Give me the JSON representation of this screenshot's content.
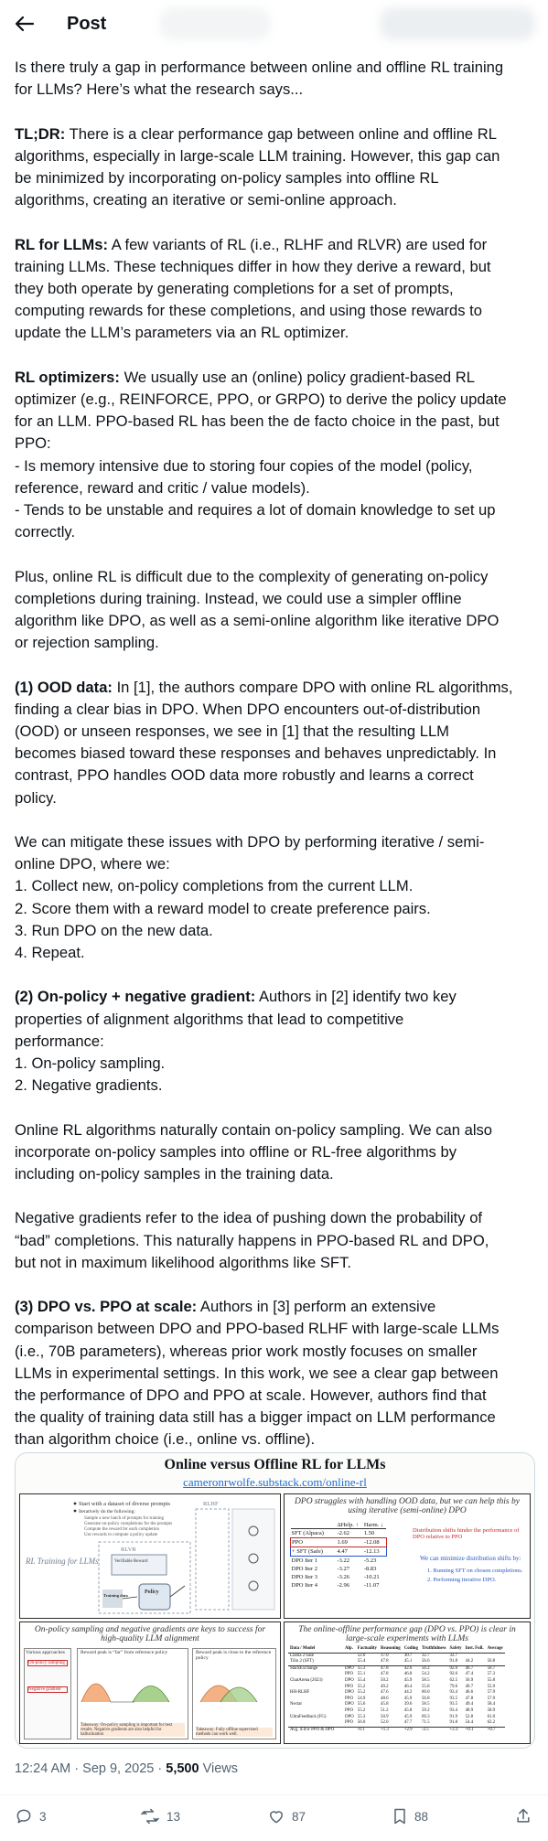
{
  "header": {
    "title": "Post"
  },
  "post": {
    "intro": [
      "Is there truly a gap in performance between online and offline RL training",
      "for LLMs? Here’s what the research says..."
    ],
    "tldr": {
      "label": "TL;DR:",
      "lines": [
        " There is a clear performance gap between online and offline RL",
        "algorithms, especially in large-scale LLM training. However, this gap can",
        "be minimized by incorporating on-policy samples into offline RL",
        "algorithms, creating an iterative or semi-online approach."
      ]
    },
    "rl_for_llms": {
      "label": "RL for LLMs:",
      "lines": [
        " A few variants of RL (i.e., RLHF and RLVR) are used for",
        "training LLMs. These techniques differ in how they derive a reward, but",
        "they both operate by generating completions for a set of prompts,",
        "computing rewards for these completions, and using those rewards to",
        "update the LLM’s parameters via an RL optimizer."
      ]
    },
    "rl_optimizers": {
      "label": "RL optimizers:",
      "lines": [
        " We usually use an (online) policy gradient-based RL",
        "optimizer (e.g., REINFORCE, PPO, or GRPO) to derive the policy update",
        "for an LLM. PPO-based RL has been the de facto choice in the past, but",
        "PPO:",
        "- Is memory intensive due to storing four copies of the model (policy,",
        "reference, reward and critic / value models).",
        "- Tends to be unstable and requires a lot of domain knowledge to set up",
        "correctly."
      ]
    },
    "plus": [
      "Plus, online RL is difficult due to the complexity of generating on-policy",
      "completions during training. Instead, we could use a simpler offline",
      "algorithm like DPO, as well as a semi-online algorithm like iterative DPO",
      "or rejection sampling."
    ],
    "ood": {
      "label": "(1) OOD data:",
      "lines": [
        " In [1], the authors compare DPO with online RL algorithms,",
        "finding a clear bias in DPO. When DPO encounters out-of-distribution",
        "(OOD) or unseen responses, we see in [1] that the resulting LLM",
        "becomes biased toward these responses and behaves unpredictably. In",
        "contrast, PPO handles OOD data more robustly and learns a correct",
        "policy."
      ]
    },
    "mitigate": [
      "We can mitigate these issues with DPO by performing iterative / semi-",
      "online DPO, where we:",
      "1. Collect new, on-policy completions from the current LLM.",
      "2. Score them with a reward model to create preference pairs.",
      "3. Run DPO on the new data.",
      "4. Repeat."
    ],
    "onpolicy": {
      "label": "(2) On-policy + negative gradient:",
      "lines": [
        " Authors in [2] identify two key",
        "properties of alignment algorithms that lead to competitive",
        "performance:",
        "1. On-policy sampling.",
        "2. Negative gradients."
      ]
    },
    "online_rl": [
      "Online RL algorithms naturally contain on-policy sampling. We can also",
      "incorporate on-policy samples into offline or RL-free algorithms by",
      "including on-policy samples in the training data."
    ],
    "neg_grad": [
      "Negative gradients refer to the idea of pushing down the probability of",
      "“bad” completions. This naturally happens in PPO-based RL and DPO,",
      "but not in maximum likelihood algorithms like SFT."
    ],
    "dpo_ppo": {
      "label": "(3) DPO vs. PPO at scale:",
      "lines": [
        " Authors in [3] perform an extensive",
        "comparison between DPO and PPO-based RLHF with large-scale LLMs",
        "(i.e., 70B parameters), whereas prior work mostly focuses on smaller",
        "LLMs in experimental settings. In this work, we see a clear gap between",
        "the performance of DPO and PPO at scale. However, authors find that",
        "the quality of training data still has a bigger impact on LLM performance",
        "than algorithm choice (i.e., online vs. offline)."
      ]
    }
  },
  "figure": {
    "title": "Online versus Offline RL for LLMs",
    "link": "cameronrwolfe.substack.com/online-rl",
    "p1": {
      "label": "RL Training for LLMs",
      "bullets": [
        "Start with a dataset of diverse prompts",
        "Iteratively do the following:",
        "Sample a new batch of prompts for training",
        "Generate on-policy completions for the prompts",
        "Compute the reward for each completion",
        "Use rewards to compute a policy update"
      ],
      "rlhf": "RLHF",
      "rlvr": "RLVR",
      "verifiable": "Verifiable Reward",
      "training_data": "Training data",
      "policy": "Policy"
    },
    "p2": {
      "title": "DPO struggles with handling OOD data, but we can help this by using iterative (semi-online) DPO",
      "cols": [
        "ΔHelp. ↑",
        "Harm. ↓"
      ],
      "rows": [
        [
          "SFT (Alpaca)",
          "-2.62",
          "1.50"
        ],
        [
          "PPO",
          "1.69",
          "-12.08"
        ],
        [
          "+ SFT (Safe)",
          "4.47",
          "-12.13"
        ],
        [
          "DPO Iter 1",
          "-3.22",
          "-5.23"
        ],
        [
          "DPO Iter 2",
          "-3.27",
          "-8.83"
        ],
        [
          "DPO Iter 3",
          "-3.26",
          "-10.21"
        ],
        [
          "DPO Iter 4",
          "-2.96",
          "-11.07"
        ]
      ],
      "note_red": "Distribution shifts hinder the performance of DPO relative to PPO",
      "note_blue": "We can minimize distribution shifts by:",
      "steps": [
        "1.  Running SFT on chosen completions.",
        "2.  Performing iterative DPO."
      ]
    },
    "p3": {
      "title": "On-policy sampling and negative gradients are keys to success for high-quality LLM alignment",
      "labels": [
        "Various approaches",
        "On-policy sampling",
        "Negative gradient",
        "Reward peak is “far” from reference policy",
        "Reward peak is close to the reference policy"
      ],
      "takeaway1": "Takeaway: On-policy sampling is important for best results. Negative gradients are also helpful for hallucination",
      "takeaway2": "Takeaway: Fully offline supervised methods can work well."
    },
    "p4": {
      "title": "The online-offline performance gap (DPO vs. PPO) is clear in large-scale experiments with LLMs",
      "cols": [
        "Data / Model",
        "Alp.",
        "Factuality",
        "Reasoning",
        "Coding",
        "Truthfulness",
        "Safety",
        "Inst. Foll.",
        "Average"
      ],
      "rows": [
        [
          "Llama 2 base",
          "",
          "52.0",
          "37.0",
          "30.7",
          "32.7",
          "32.7",
          "",
          ""
        ],
        [
          "Tülu 2 (SFT)",
          "",
          "55.4",
          "47.8",
          "45.1",
          "56.6",
          "91.8",
          "44.2",
          "56.8"
        ],
        [
          "StackExchange",
          "DPO",
          "55.3",
          "47.8",
          "42.6",
          "56.2",
          "92.0",
          "46.7",
          "56.7"
        ],
        [
          "",
          "PPO",
          "55.1",
          "47.8",
          "46.8",
          "54.2",
          "92.6",
          "47.4",
          "57.3"
        ],
        [
          "ChatArena (2023)",
          "DPO",
          "55.4",
          "50.2",
          "45.9",
          "58.5",
          "62.5",
          "56.9",
          "55.8"
        ],
        [
          "",
          "PPO",
          "55.2",
          "49.2",
          "46.4",
          "55.8",
          "79.6",
          "49.7",
          "55.9"
        ],
        [
          "HH-RLHF",
          "DPO",
          "55.2",
          "47.6",
          "44.2",
          "60.0",
          "93.4",
          "46.6",
          "57.9"
        ],
        [
          "",
          "PPO",
          "54.9",
          "48.6",
          "45.9",
          "56.8",
          "93.5",
          "47.8",
          "57.9"
        ],
        [
          "Nectar",
          "DPO",
          "55.6",
          "45.8",
          "39.6",
          "58.5",
          "93.5",
          "49.4",
          "58.4"
        ],
        [
          "",
          "PPO",
          "55.2",
          "51.2",
          "45.8",
          "59.2",
          "93.4",
          "48.9",
          "58.9"
        ],
        [
          "UltraFeedback (FG)",
          "DPO",
          "55.3",
          "50.9",
          "45.9",
          "69.3",
          "91.9",
          "52.8",
          "61.0"
        ],
        [
          "",
          "PPO",
          "56.0",
          "52.0",
          "47.7",
          "71.5",
          "91.8",
          "54.4",
          "62.2"
        ],
        [
          "Avg. Δ b/w PPO & DPO",
          "",
          "-0.1",
          "+1.3",
          "+2.9",
          "-2.5",
          "+2.3",
          "+0.1",
          "+0.7"
        ]
      ]
    }
  },
  "meta": {
    "time": "12:24 AM · Sep 9, 2025 · ",
    "views": "5,500",
    "views_label": " Views"
  },
  "actions": {
    "replies": "3",
    "reposts": "13",
    "likes": "87",
    "bookmarks": "88"
  }
}
